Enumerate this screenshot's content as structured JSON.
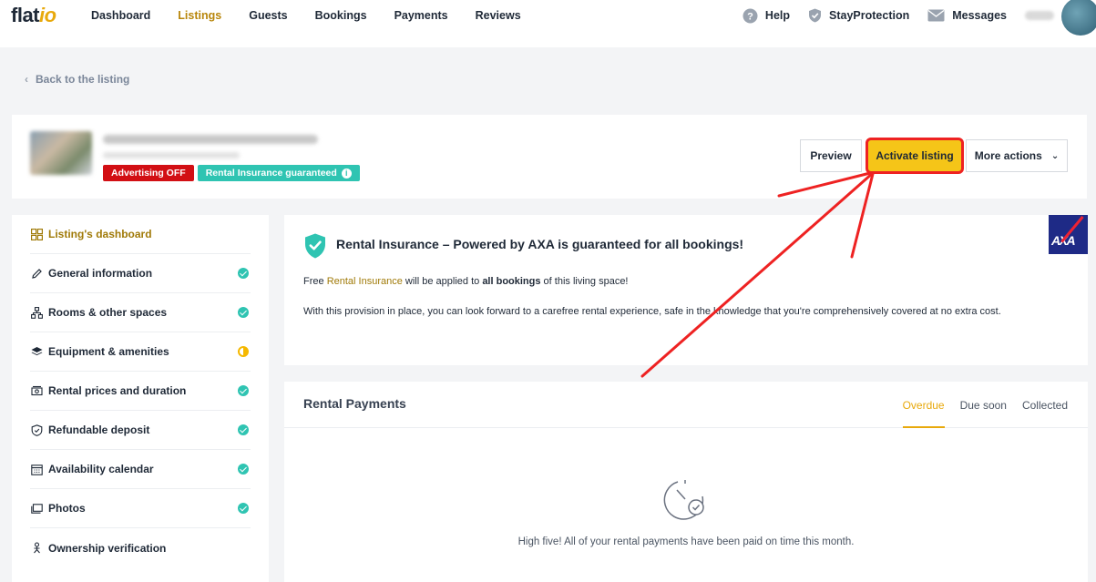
{
  "nav": {
    "logo_main": "flat",
    "logo_accent": "io",
    "links": [
      "Dashboard",
      "Listings",
      "Guests",
      "Bookings",
      "Payments",
      "Reviews"
    ],
    "active": "Listings",
    "help": "Help",
    "stay_protection": "StayProtection",
    "messages": "Messages"
  },
  "back_link": "Back to the listing",
  "listing": {
    "badge_advertising": "Advertising OFF",
    "badge_insurance": "Rental Insurance guaranteed",
    "info_glyph": "i"
  },
  "actions": {
    "preview": "Preview",
    "activate": "Activate listing",
    "more": "More actions"
  },
  "sidebar": {
    "items": [
      {
        "label": "Listing's dashboard",
        "status": "none",
        "icon": "grid-icon"
      },
      {
        "label": "General information",
        "status": "ok",
        "icon": "pencil-icon"
      },
      {
        "label": "Rooms & other spaces",
        "status": "ok",
        "icon": "rooms-icon"
      },
      {
        "label": "Equipment & amenities",
        "status": "partial",
        "icon": "layers-icon"
      },
      {
        "label": "Rental prices and duration",
        "status": "ok",
        "icon": "money-icon"
      },
      {
        "label": "Refundable deposit",
        "status": "ok",
        "icon": "shield-icon"
      },
      {
        "label": "Availability calendar",
        "status": "ok",
        "icon": "calendar-icon"
      },
      {
        "label": "Photos",
        "status": "ok",
        "icon": "photo-icon"
      },
      {
        "label": "Ownership verification",
        "status": "none",
        "icon": "person-icon"
      }
    ]
  },
  "insurance": {
    "title": "Rental Insurance – Powered by AXA is guaranteed for all bookings!",
    "p1_pre": "Free ",
    "p1_link": "Rental Insurance",
    "p1_mid": " will be applied to ",
    "p1_bold": "all bookings",
    "p1_post": " of this living space!",
    "p2": "With this provision in place, you can look forward to a carefree rental experience, safe in the knowledge that you're comprehensively covered at no extra cost.",
    "axa_logo": "AXA"
  },
  "payments": {
    "title": "Rental Payments",
    "tabs": [
      "Overdue",
      "Due soon",
      "Collected"
    ],
    "active_tab": "Overdue",
    "message": "High five! All of your rental payments have been paid on time this month."
  },
  "colors": {
    "accent": "#e8a90c",
    "activate_bg": "#f5c518",
    "annotation": "#ee2222",
    "success": "#2fc4b2",
    "danger": "#d20f14"
  }
}
